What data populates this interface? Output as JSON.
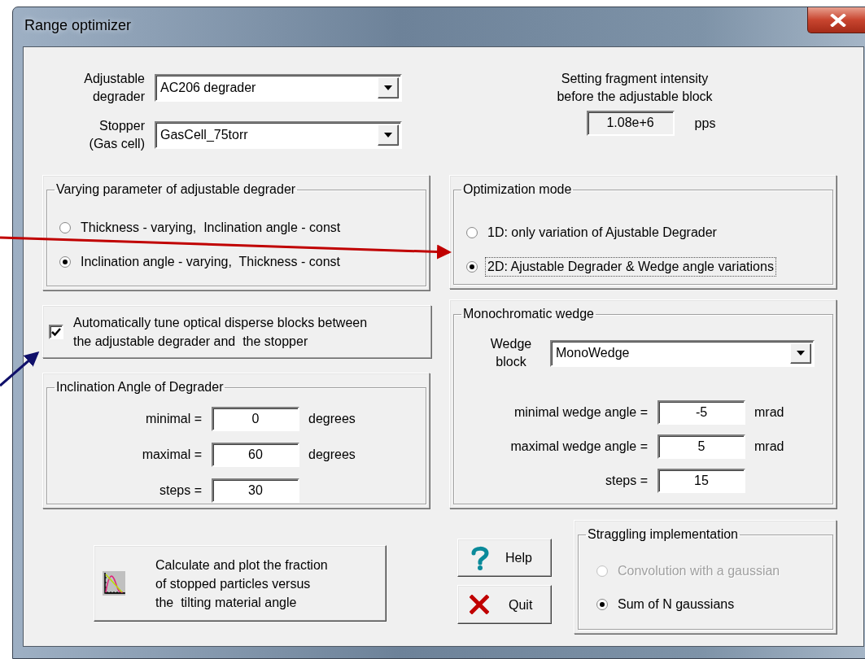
{
  "window": {
    "title": "Range optimizer"
  },
  "selectors": [
    {
      "label": "Adjustable degrader",
      "value": "AC206 degrader"
    },
    {
      "label": "Stopper (Gas cell)",
      "value": "GasCell_75torr"
    }
  ],
  "intensity": {
    "caption": "Setting fragment intensity before the adjustable block",
    "value": "1.08e+6",
    "unit": "pps"
  },
  "varying_parameter": {
    "title": "Varying parameter of adjustable degrader",
    "options": [
      {
        "label": "Thickness - varying,  Inclination angle - const",
        "selected": false
      },
      {
        "label": "Inclination angle - varying,  Thickness - const",
        "selected": true
      }
    ]
  },
  "optimization_mode": {
    "title": "Optimization mode",
    "options": [
      {
        "label": "1D: only variation of Ajustable Degrader",
        "selected": false,
        "focused": false
      },
      {
        "label": "2D: Ajustable Degrader & Wedge angle variations",
        "selected": true,
        "focused": true
      }
    ]
  },
  "auto_tune": {
    "label": "Automatically tune optical disperse blocks between the adjustable degrader and  the stopper",
    "checked": true
  },
  "inclination": {
    "title": "Inclination Angle of Degrader",
    "fields": [
      {
        "label": "minimal =",
        "value": "0",
        "unit": "degrees"
      },
      {
        "label": "maximal =",
        "value": "60",
        "unit": "degrees"
      },
      {
        "label": "steps =",
        "value": "30"
      }
    ]
  },
  "wedge": {
    "title": "Monochromatic wedge",
    "block_label": "Wedge block",
    "block_value": "MonoWedge",
    "fields": [
      {
        "label": "minimal wedge angle =",
        "value": "-5",
        "unit": "mrad"
      },
      {
        "label": "maximal wedge angle =",
        "value": "5",
        "unit": "mrad"
      },
      {
        "label": "steps  =",
        "value": "15"
      }
    ]
  },
  "calculate_button": {
    "label": "Calculate and plot the fraction\nof stopped particles versus\nthe  tilting material angle"
  },
  "help_button": {
    "label": "Help"
  },
  "quit_button": {
    "label": "Quit"
  },
  "straggling": {
    "title": "Straggling implementation",
    "options": [
      {
        "label": "Convolution with a gaussian",
        "selected": false,
        "disabled": true
      },
      {
        "label": "Sum of N gaussians",
        "selected": true,
        "disabled": false
      }
    ]
  }
}
